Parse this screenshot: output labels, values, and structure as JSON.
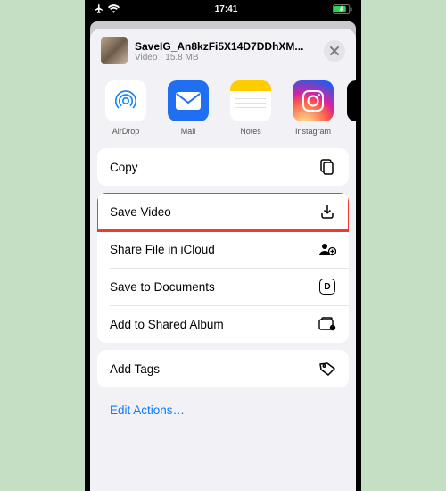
{
  "status": {
    "time": "17:41"
  },
  "file": {
    "name": "SaveIG_An8kzFi5X14D7DDhXM...",
    "meta": "Video · 15.8 MB"
  },
  "apps": {
    "airdrop": "AirDrop",
    "mail": "Mail",
    "notes": "Notes",
    "instagram": "Instagram"
  },
  "actions": {
    "copy": "Copy",
    "saveVideo": "Save Video",
    "shareICloud": "Share File in iCloud",
    "saveDocs": "Save to Documents",
    "addShared": "Add to Shared Album",
    "addTags": "Add Tags"
  },
  "edit": "Edit Actions…"
}
